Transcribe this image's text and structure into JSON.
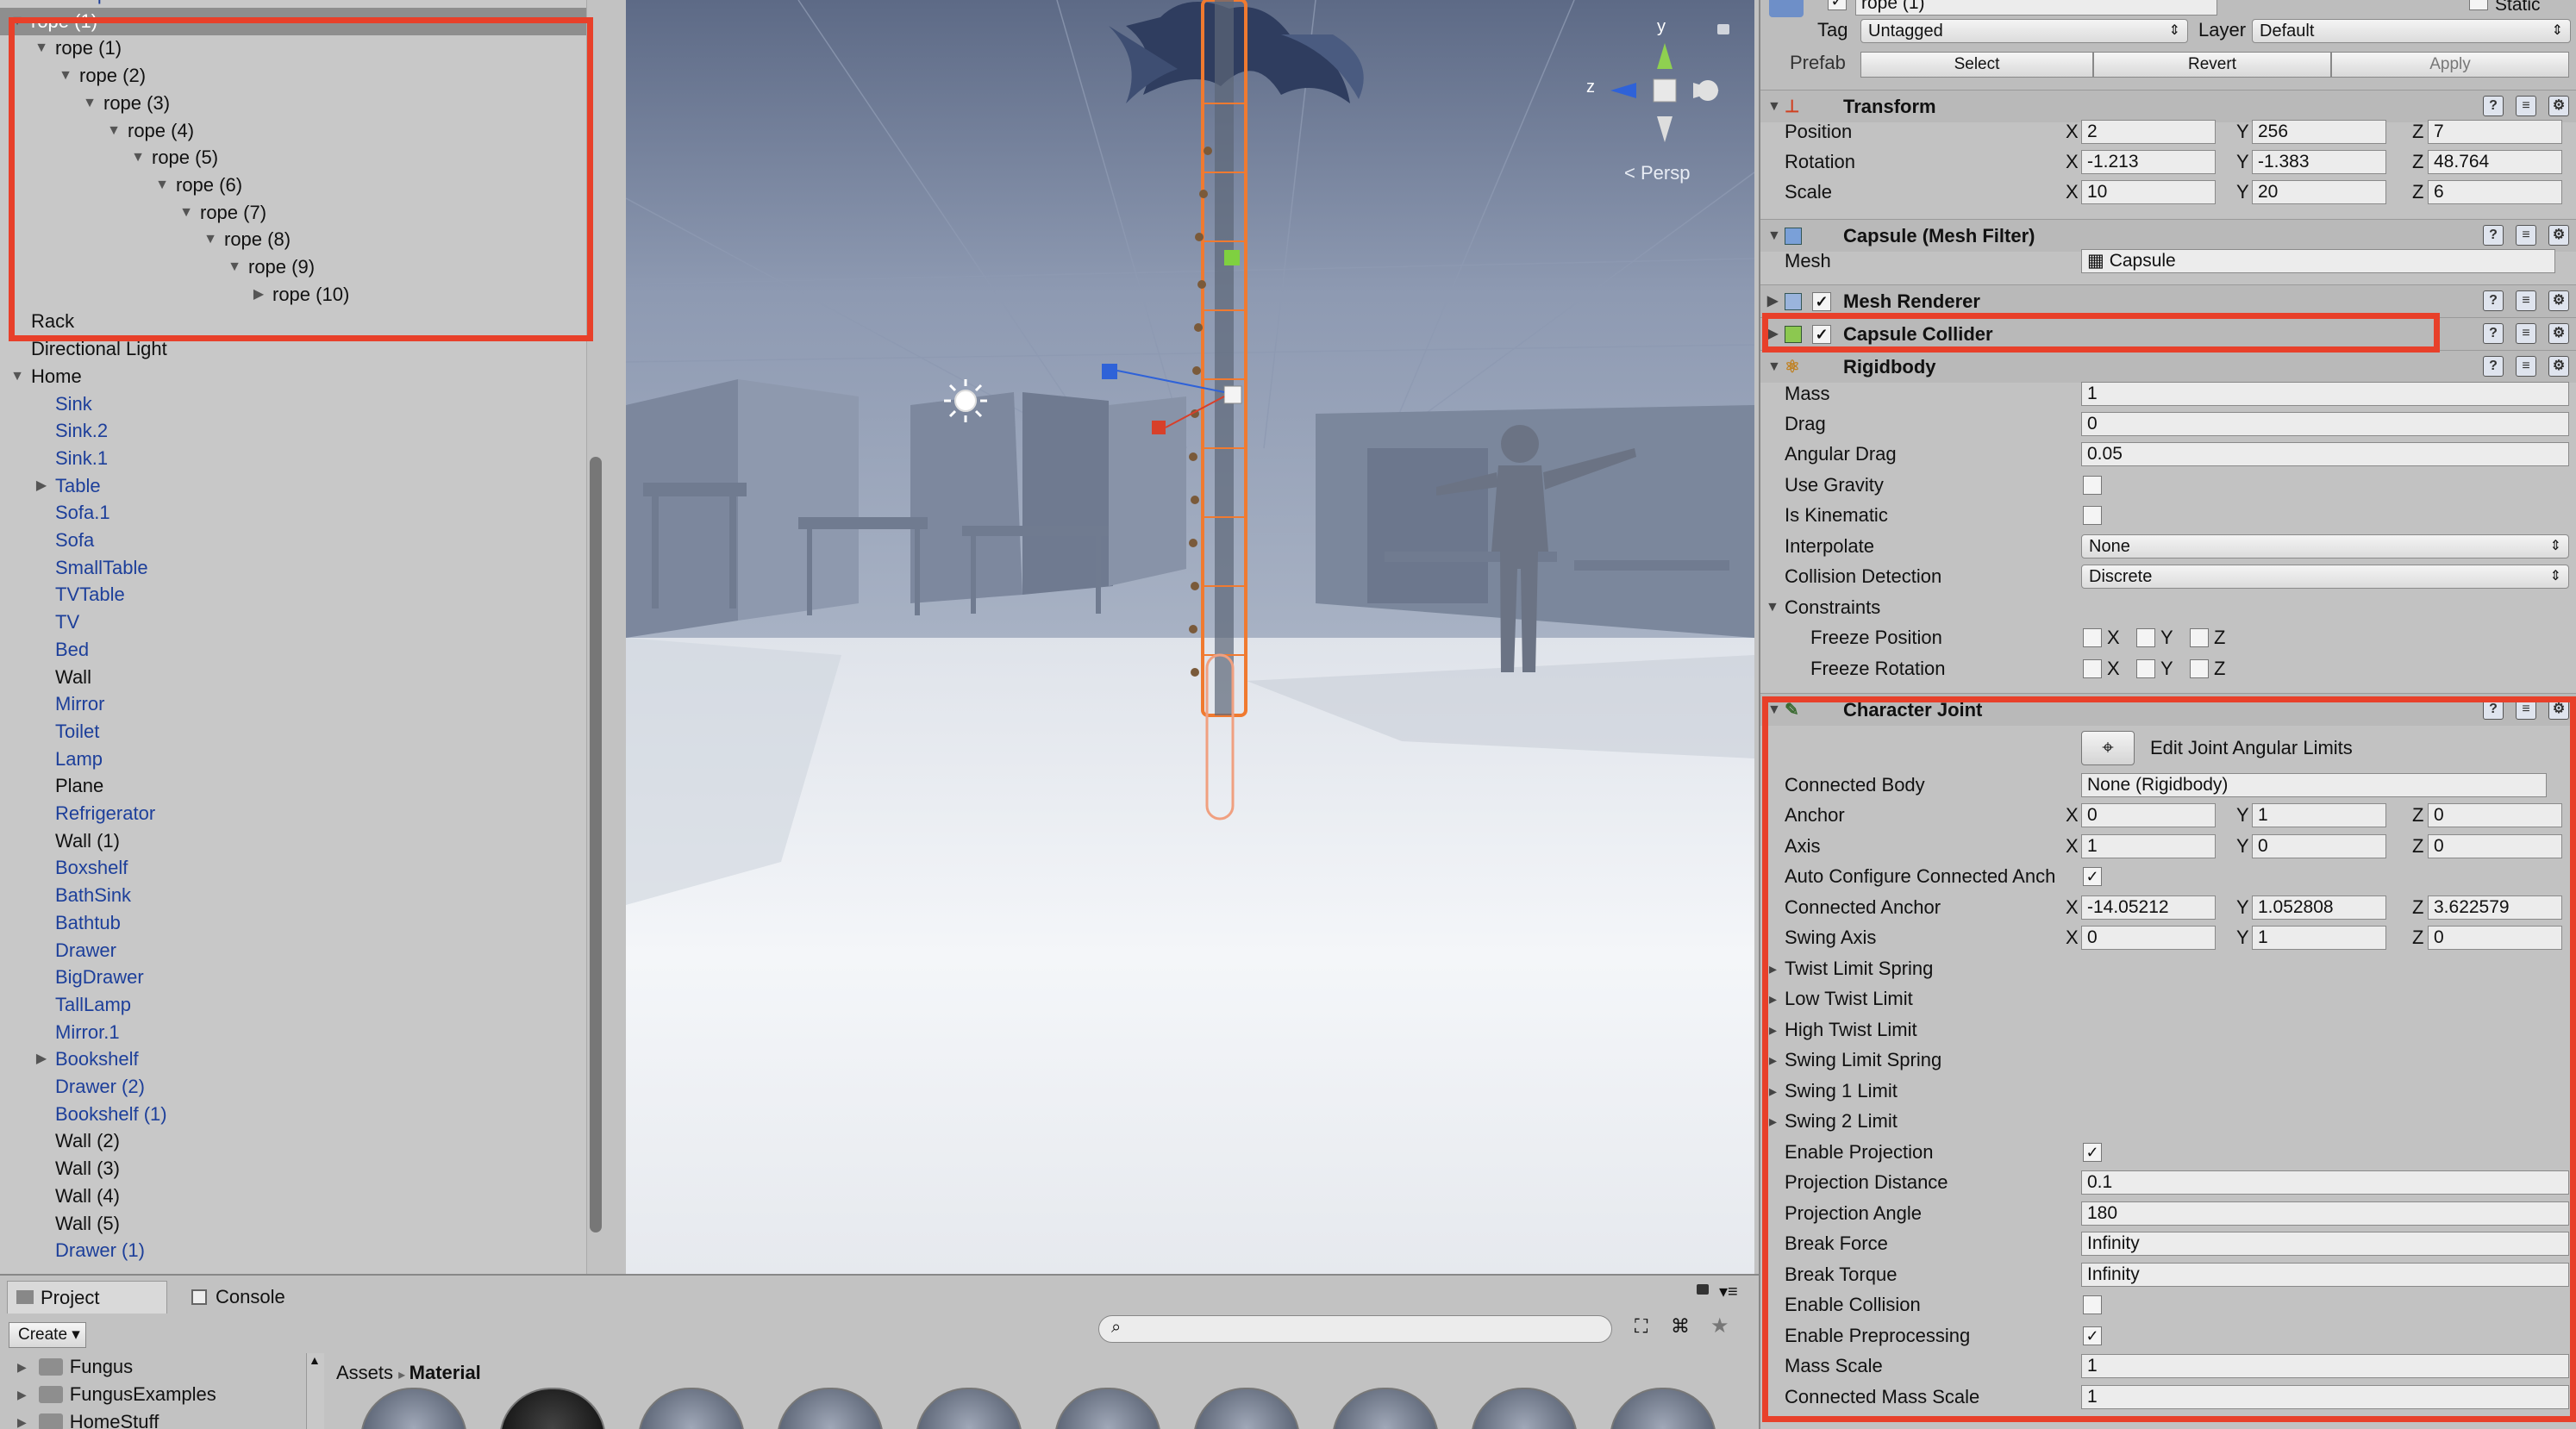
{
  "hierarchy": {
    "items": [
      {
        "label": "transparentCube",
        "depth": 2,
        "arrow": "none",
        "blue": true
      },
      {
        "label": "rope (1)",
        "depth": 1,
        "arrow": "down",
        "selected": true
      },
      {
        "label": "rope (1)",
        "depth": 2,
        "arrow": "down"
      },
      {
        "label": "rope (2)",
        "depth": 3,
        "arrow": "down"
      },
      {
        "label": "rope (3)",
        "depth": 4,
        "arrow": "down"
      },
      {
        "label": "rope (4)",
        "depth": 5,
        "arrow": "down"
      },
      {
        "label": "rope (5)",
        "depth": 6,
        "arrow": "down"
      },
      {
        "label": "rope (6)",
        "depth": 7,
        "arrow": "down"
      },
      {
        "label": "rope (7)",
        "depth": 8,
        "arrow": "down"
      },
      {
        "label": "rope (8)",
        "depth": 9,
        "arrow": "down"
      },
      {
        "label": "rope (9)",
        "depth": 10,
        "arrow": "down"
      },
      {
        "label": "rope (10)",
        "depth": 11,
        "arrow": "right"
      },
      {
        "label": "Rack",
        "depth": 1,
        "arrow": "none"
      },
      {
        "label": "Directional Light",
        "depth": 1,
        "arrow": "none"
      },
      {
        "label": "Home",
        "depth": 1,
        "arrow": "down"
      },
      {
        "label": "Sink",
        "depth": 2,
        "arrow": "none",
        "blue": true
      },
      {
        "label": "Sink.2",
        "depth": 2,
        "arrow": "none",
        "blue": true
      },
      {
        "label": "Sink.1",
        "depth": 2,
        "arrow": "none",
        "blue": true
      },
      {
        "label": "Table",
        "depth": 2,
        "arrow": "right",
        "blue": true
      },
      {
        "label": "Sofa.1",
        "depth": 2,
        "arrow": "none",
        "blue": true
      },
      {
        "label": "Sofa",
        "depth": 2,
        "arrow": "none",
        "blue": true
      },
      {
        "label": "SmallTable",
        "depth": 2,
        "arrow": "none",
        "blue": true
      },
      {
        "label": "TVTable",
        "depth": 2,
        "arrow": "none",
        "blue": true
      },
      {
        "label": "TV",
        "depth": 2,
        "arrow": "none",
        "blue": true
      },
      {
        "label": "Bed",
        "depth": 2,
        "arrow": "none",
        "blue": true
      },
      {
        "label": "Wall",
        "depth": 2,
        "arrow": "none"
      },
      {
        "label": "Mirror",
        "depth": 2,
        "arrow": "none",
        "blue": true
      },
      {
        "label": "Toilet",
        "depth": 2,
        "arrow": "none",
        "blue": true
      },
      {
        "label": "Lamp",
        "depth": 2,
        "arrow": "none",
        "blue": true
      },
      {
        "label": "Plane",
        "depth": 2,
        "arrow": "none"
      },
      {
        "label": "Refrigerator",
        "depth": 2,
        "arrow": "none",
        "blue": true
      },
      {
        "label": "Wall (1)",
        "depth": 2,
        "arrow": "none"
      },
      {
        "label": "Boxshelf",
        "depth": 2,
        "arrow": "none",
        "blue": true
      },
      {
        "label": "BathSink",
        "depth": 2,
        "arrow": "none",
        "blue": true
      },
      {
        "label": "Bathtub",
        "depth": 2,
        "arrow": "none",
        "blue": true
      },
      {
        "label": "Drawer",
        "depth": 2,
        "arrow": "none",
        "blue": true
      },
      {
        "label": "BigDrawer",
        "depth": 2,
        "arrow": "none",
        "blue": true
      },
      {
        "label": "TallLamp",
        "depth": 2,
        "arrow": "none",
        "blue": true
      },
      {
        "label": "Mirror.1",
        "depth": 2,
        "arrow": "none",
        "blue": true
      },
      {
        "label": "Bookshelf",
        "depth": 2,
        "arrow": "right",
        "blue": true
      },
      {
        "label": "Drawer (2)",
        "depth": 2,
        "arrow": "none",
        "blue": true
      },
      {
        "label": "Bookshelf (1)",
        "depth": 2,
        "arrow": "none",
        "blue": true
      },
      {
        "label": "Wall (2)",
        "depth": 2,
        "arrow": "none"
      },
      {
        "label": "Wall (3)",
        "depth": 2,
        "arrow": "none"
      },
      {
        "label": "Wall (4)",
        "depth": 2,
        "arrow": "none"
      },
      {
        "label": "Wall (5)",
        "depth": 2,
        "arrow": "none"
      },
      {
        "label": "Drawer (1)",
        "depth": 2,
        "arrow": "none",
        "blue": true
      }
    ]
  },
  "scene": {
    "persp_label": "Persp",
    "gizmo_y": "y",
    "gizmo_z": "z"
  },
  "inspector": {
    "object_name": "rope (1)",
    "static_label": "Static",
    "tag_label": "Tag",
    "tag_value": "Untagged",
    "layer_label": "Layer",
    "layer_value": "Default",
    "prefab_label": "Prefab",
    "prefab_select": "Select",
    "prefab_revert": "Revert",
    "prefab_apply": "Apply",
    "transform": {
      "title": "Transform",
      "position": {
        "label": "Position",
        "x": "2",
        "y": "256",
        "z": "7"
      },
      "rotation": {
        "label": "Rotation",
        "x": "-1.213",
        "y": "-1.383",
        "z": "48.764"
      },
      "scale": {
        "label": "Scale",
        "x": "10",
        "y": "20",
        "z": "6"
      }
    },
    "mesh_filter": {
      "title": "Capsule (Mesh Filter)",
      "mesh_label": "Mesh",
      "mesh_value": "Capsule"
    },
    "mesh_renderer": {
      "title": "Mesh Renderer"
    },
    "capsule_collider": {
      "title": "Capsule Collider"
    },
    "rigidbody": {
      "title": "Rigidbody",
      "mass_label": "Mass",
      "mass": "1",
      "drag_label": "Drag",
      "drag": "0",
      "angular_drag_label": "Angular Drag",
      "angular_drag": "0.05",
      "use_gravity_label": "Use Gravity",
      "is_kinematic_label": "Is Kinematic",
      "interpolate_label": "Interpolate",
      "interpolate": "None",
      "collision_label": "Collision Detection",
      "collision": "Discrete",
      "constraints_label": "Constraints",
      "freeze_pos_label": "Freeze Position",
      "freeze_rot_label": "Freeze Rotation"
    },
    "character_joint": {
      "title": "Character Joint",
      "edit_limits": "Edit Joint Angular Limits",
      "connected_body_label": "Connected Body",
      "connected_body": "None (Rigidbody)",
      "anchor": {
        "label": "Anchor",
        "x": "0",
        "y": "1",
        "z": "0"
      },
      "axis": {
        "label": "Axis",
        "x": "1",
        "y": "0",
        "z": "0"
      },
      "auto_configure_label": "Auto Configure Connected Anch",
      "connected_anchor": {
        "label": "Connected Anchor",
        "x": "-14.05212",
        "y": "1.052808",
        "z": "3.622579"
      },
      "swing_axis": {
        "label": "Swing Axis",
        "x": "0",
        "y": "1",
        "z": "0"
      },
      "twist_limit_spring": "Twist Limit Spring",
      "low_twist_limit": "Low Twist Limit",
      "high_twist_limit": "High Twist Limit",
      "swing_limit_spring": "Swing Limit Spring",
      "swing1_limit": "Swing 1 Limit",
      "swing2_limit": "Swing 2 Limit",
      "enable_projection_label": "Enable Projection",
      "projection_distance_label": "Projection Distance",
      "projection_distance": "0.1",
      "projection_angle_label": "Projection Angle",
      "projection_angle": "180",
      "break_force_label": "Break Force",
      "break_force": "Infinity",
      "break_torque_label": "Break Torque",
      "break_torque": "Infinity",
      "enable_collision_label": "Enable Collision",
      "enable_preprocessing_label": "Enable Preprocessing",
      "mass_scale_label": "Mass Scale",
      "mass_scale": "1",
      "connected_mass_scale_label": "Connected Mass Scale",
      "connected_mass_scale": "1"
    }
  },
  "axes": {
    "x": "X",
    "y": "Y",
    "z": "Z"
  },
  "bottom": {
    "tab_project": "Project",
    "tab_console": "Console",
    "create": "Create",
    "folders": [
      "Fungus",
      "FungusExamples",
      "HomeStuff"
    ],
    "breadcrumb_root": "Assets",
    "breadcrumb_current": "Material"
  }
}
